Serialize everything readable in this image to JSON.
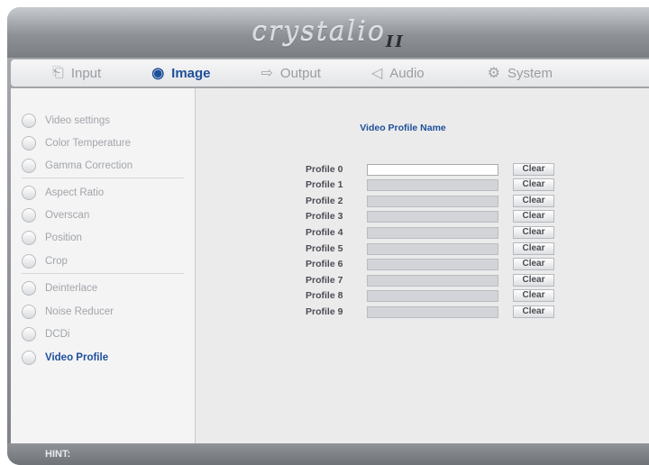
{
  "header": {
    "logo_text": "crystalio",
    "logo_suffix": "II"
  },
  "tabs": [
    {
      "label": "Input",
      "icon": "input-icon",
      "glyph": "⎗",
      "active": false
    },
    {
      "label": "Image",
      "icon": "eye-icon",
      "glyph": "◉",
      "active": true
    },
    {
      "label": "Output",
      "icon": "output-icon",
      "glyph": "⇨",
      "active": false
    },
    {
      "label": "Audio",
      "icon": "speaker-icon",
      "glyph": "◁",
      "active": false
    },
    {
      "label": "System",
      "icon": "gear-icon",
      "glyph": "⚙",
      "active": false
    }
  ],
  "sidebar": {
    "items": [
      {
        "label": "Video settings"
      },
      {
        "label": "Color Temperature"
      },
      {
        "label": "Gamma Correction"
      },
      {
        "label": "Aspect Ratio"
      },
      {
        "label": "Overscan"
      },
      {
        "label": "Position"
      },
      {
        "label": "Crop"
      },
      {
        "label": "Deinterlace"
      },
      {
        "label": "Noise Reducer"
      },
      {
        "label": "DCDi"
      },
      {
        "label": "Video Profile",
        "active": true
      }
    ]
  },
  "content": {
    "title": "Video Profile Name",
    "clear_label": "Clear",
    "profiles": [
      {
        "label": "Profile 0",
        "value": "",
        "active": true
      },
      {
        "label": "Profile 1",
        "value": ""
      },
      {
        "label": "Profile 2",
        "value": ""
      },
      {
        "label": "Profile 3",
        "value": ""
      },
      {
        "label": "Profile 4",
        "value": ""
      },
      {
        "label": "Profile 5",
        "value": ""
      },
      {
        "label": "Profile 6",
        "value": ""
      },
      {
        "label": "Profile 7",
        "value": ""
      },
      {
        "label": "Profile 8",
        "value": ""
      },
      {
        "label": "Profile 9",
        "value": ""
      }
    ]
  },
  "footer": {
    "hint_label": "HINT:"
  },
  "colors": {
    "accent": "#1e4f9a",
    "inactive_text": "#a2a5a9"
  }
}
